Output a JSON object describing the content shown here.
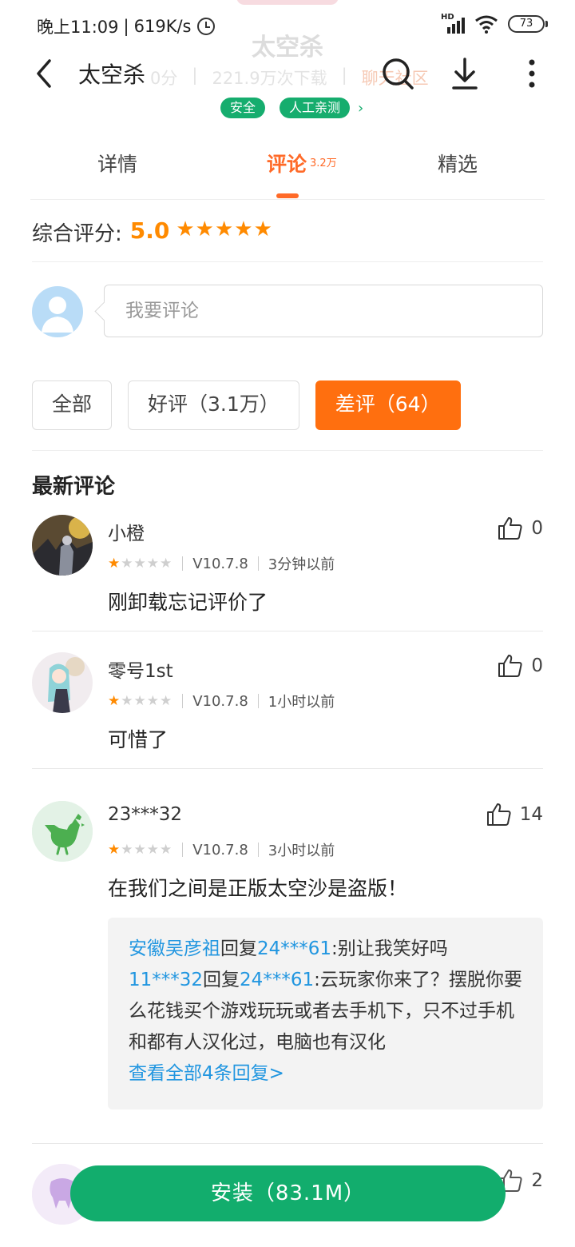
{
  "status_bar": {
    "time": "晚上11:09",
    "speed": "619K/s",
    "network_label": "HD",
    "battery": "73"
  },
  "background_header": {
    "title": "太空杀",
    "score": "0分",
    "downloads": "221.9万次下载",
    "link": "聊天社区"
  },
  "nav": {
    "title": "太空杀",
    "back_icon": "back-arrow-icon",
    "search_icon": "search-icon",
    "download_icon": "download-icon",
    "more_icon": "more-vertical-icon"
  },
  "tags": [
    "安全",
    "人工亲测"
  ],
  "tabs": [
    {
      "label": "详情",
      "badge": ""
    },
    {
      "label": "评论",
      "badge": "3.2万"
    },
    {
      "label": "精选",
      "badge": ""
    }
  ],
  "overall": {
    "label": "综合评分:",
    "score": "5.0",
    "stars": "★★★★★",
    "star_count": 5
  },
  "comment_input": {
    "placeholder": "我要评论"
  },
  "filters": [
    {
      "label": "全部",
      "active": false
    },
    {
      "label": "好评（3.1万）",
      "active": false
    },
    {
      "label": "差评（64）",
      "active": true
    }
  ],
  "section_title": "最新评论",
  "reviews": [
    {
      "user": "小橙",
      "likes": "0",
      "rating": 1,
      "version": "V10.7.8",
      "time": "3分钟以前",
      "text": "刚卸载忘记评价了"
    },
    {
      "user": "零号1st",
      "likes": "0",
      "rating": 1,
      "version": "V10.7.8",
      "time": "1小时以前",
      "text": "可惜了"
    },
    {
      "user": "23***32",
      "likes": "14",
      "rating": 1,
      "version": "V10.7.8",
      "time": "3小时以前",
      "text": "在我们之间是正版太空沙是盗版！",
      "replies": [
        {
          "from": "安徽吴彦祖",
          "verb": "回复",
          "to": "24***61",
          "text": ":别让我笑好吗"
        },
        {
          "from": "11***32",
          "verb": "回复",
          "to": "24***61",
          "text": ":云玩家你来了？摆脱你要么花钱买个游戏玩玩或者去手机下，只不过手机和都有人汉化过，电脑也有汉化"
        }
      ],
      "more_replies": "查看全部4条回复>"
    },
    {
      "likes": "2"
    }
  ],
  "install_button": "安装（83.1M）",
  "colors": {
    "accent": "#ff6a28",
    "star": "#ff8a00",
    "green": "#12ad6d",
    "link": "#2196e0"
  }
}
